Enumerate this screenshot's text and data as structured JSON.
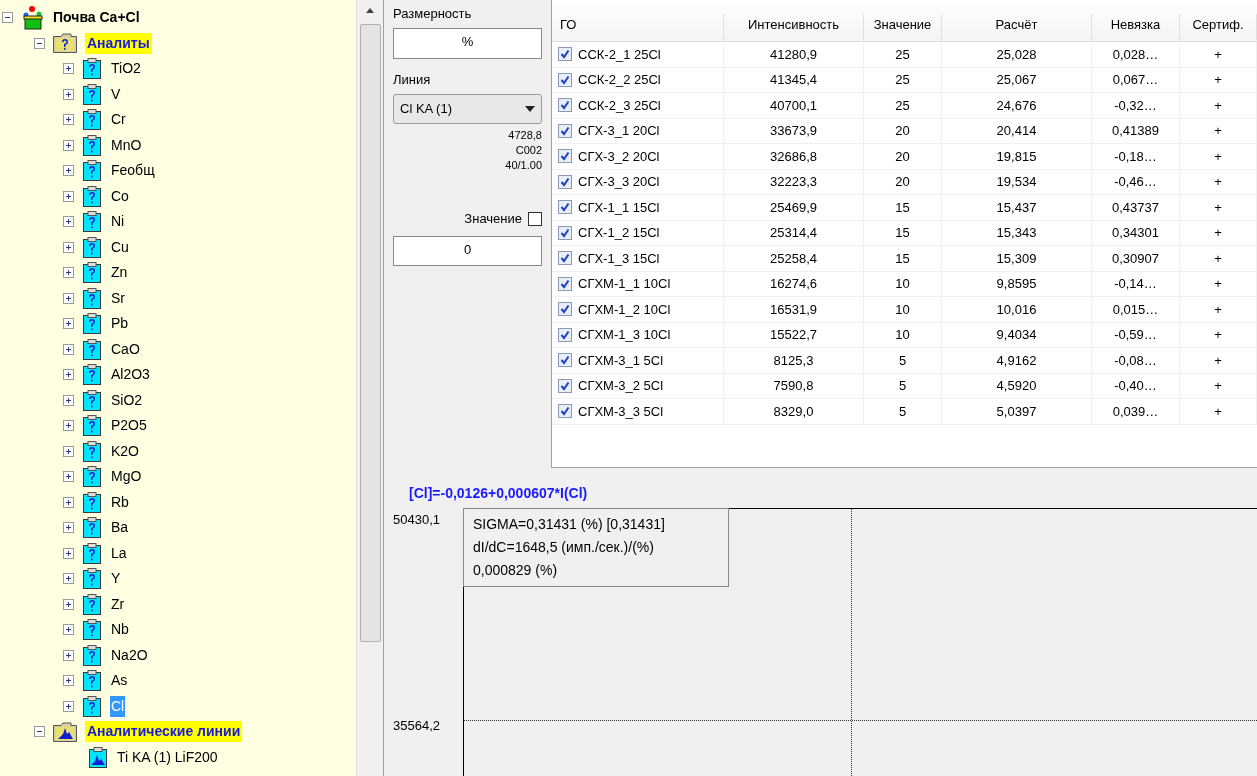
{
  "tree": {
    "label": "Почва Ca+Cl",
    "expanded": true,
    "children": [
      {
        "label": "Аналиты",
        "kind": "analytes",
        "expanded": true,
        "highlighted": true,
        "children": [
          {
            "label": "TiO2",
            "selected": false
          },
          {
            "label": "V",
            "selected": false
          },
          {
            "label": "Cr",
            "selected": false
          },
          {
            "label": "MnO",
            "selected": false
          },
          {
            "label": "Feобщ",
            "selected": false
          },
          {
            "label": "Co",
            "selected": false
          },
          {
            "label": "Ni",
            "selected": false
          },
          {
            "label": "Cu",
            "selected": false
          },
          {
            "label": "Zn",
            "selected": false
          },
          {
            "label": "Sr",
            "selected": false
          },
          {
            "label": "Pb",
            "selected": false
          },
          {
            "label": "CaO",
            "selected": false
          },
          {
            "label": "Al2O3",
            "selected": false
          },
          {
            "label": "SiO2",
            "selected": false
          },
          {
            "label": "P2O5",
            "selected": false
          },
          {
            "label": "K2O",
            "selected": false
          },
          {
            "label": "MgO",
            "selected": false
          },
          {
            "label": "Rb",
            "selected": false
          },
          {
            "label": "Ba",
            "selected": false
          },
          {
            "label": "La",
            "selected": false
          },
          {
            "label": "Y",
            "selected": false
          },
          {
            "label": "Zr",
            "selected": false
          },
          {
            "label": "Nb",
            "selected": false
          },
          {
            "label": "Na2O",
            "selected": false
          },
          {
            "label": "As",
            "selected": false
          },
          {
            "label": "Cl",
            "selected": true
          }
        ]
      },
      {
        "label": "Аналитические линии",
        "kind": "lines",
        "expanded": true,
        "highlighted": true,
        "children": [
          {
            "label": "Ti KA (1) LiF200",
            "selected": false
          }
        ]
      }
    ]
  },
  "form": {
    "dimension_label": "Размерность",
    "dimension_value": "%",
    "line_label": "Линия",
    "line_value": "Cl KA (1)",
    "info": [
      "4728,8",
      "C002",
      "40/1.00"
    ],
    "value_label": "Значение",
    "value_checked": false,
    "value_field": "0"
  },
  "table": {
    "columns": [
      "ГО",
      "Интенсивность",
      "Значение",
      "Расчёт",
      "Невязка",
      "Сертиф."
    ],
    "rows": [
      {
        "checked": true,
        "cells": [
          "ССК-2_1 25Cl",
          "41280,9",
          "25",
          "25,028",
          "0,028…",
          "+"
        ]
      },
      {
        "checked": true,
        "cells": [
          "ССК-2_2 25Cl",
          "41345,4",
          "25",
          "25,067",
          "0,067…",
          "+"
        ]
      },
      {
        "checked": true,
        "cells": [
          "ССК-2_3 25Cl",
          "40700,1",
          "25",
          "24,676",
          "-0,32…",
          "+"
        ]
      },
      {
        "checked": true,
        "cells": [
          "СГХ-3_1 20Cl",
          "33673,9",
          "20",
          "20,414",
          "0,41389",
          "+"
        ]
      },
      {
        "checked": true,
        "cells": [
          "СГХ-3_2 20Cl",
          "32686,8",
          "20",
          "19,815",
          "-0,18…",
          "+"
        ]
      },
      {
        "checked": true,
        "cells": [
          "СГХ-3_3 20Cl",
          "32223,3",
          "20",
          "19,534",
          "-0,46…",
          "+"
        ]
      },
      {
        "checked": true,
        "cells": [
          "СГХ-1_1 15Cl",
          "25469,9",
          "15",
          "15,437",
          "0,43737",
          "+"
        ]
      },
      {
        "checked": true,
        "cells": [
          "СГХ-1_2 15Cl",
          "25314,4",
          "15",
          "15,343",
          "0,34301",
          "+"
        ]
      },
      {
        "checked": true,
        "cells": [
          "СГХ-1_3 15Cl",
          "25258,4",
          "15",
          "15,309",
          "0,30907",
          "+"
        ]
      },
      {
        "checked": true,
        "cells": [
          "СГХМ-1_1 10Cl",
          "16274,6",
          "10",
          "9,8595",
          "-0,14…",
          "+"
        ]
      },
      {
        "checked": true,
        "cells": [
          "СГХМ-1_2 10Cl",
          "16531,9",
          "10",
          "10,016",
          "0,015…",
          "+"
        ]
      },
      {
        "checked": true,
        "cells": [
          "СГХМ-1_3 10Cl",
          "15522,7",
          "10",
          "9,4034",
          "-0,59…",
          "+"
        ]
      },
      {
        "checked": true,
        "cells": [
          "СГХМ-3_1 5Cl",
          "8125,3",
          "5",
          "4,9162",
          "-0,08…",
          "+"
        ]
      },
      {
        "checked": true,
        "cells": [
          "СГХМ-3_2 5Cl",
          "7590,8",
          "5",
          "4,5920",
          "-0,40…",
          "+"
        ]
      },
      {
        "checked": true,
        "cells": [
          "СГХМ-3_3 5Cl",
          "8329,0",
          "5",
          "5,0397",
          "0,039…",
          "+"
        ]
      }
    ]
  },
  "graph": {
    "formula": "[Cl]=-0,0126+0,000607*I(Cl)",
    "y_labels": [
      "50430,1",
      "35564,2"
    ],
    "tooltip": [
      "SIGMA=0,31431 (%) [0,31431]",
      "dI/dC=1648,5 (имп./сек.)/(%)",
      "0,000829 (%)"
    ]
  }
}
